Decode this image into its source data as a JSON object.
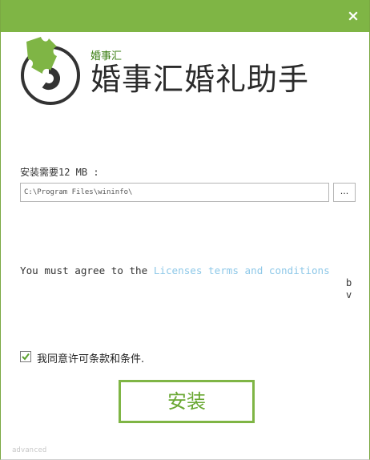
{
  "window": {
    "close_glyph": "×"
  },
  "header": {
    "logo_caption": "婚事汇",
    "title": "婚事汇婚礼助手"
  },
  "install": {
    "size_label": "安装需要12 MB :",
    "path_value": "C:\\Program Files\\wininfo\\",
    "browse_label": "..."
  },
  "license": {
    "prefix": "You must agree to the ",
    "link": "Licenses terms and conditions",
    "overflow_1": "b",
    "overflow_2": "v"
  },
  "agree": {
    "checked": true,
    "label": "我同意许可条款和条件."
  },
  "actions": {
    "install_label": "安装",
    "advanced_label": "advanced"
  },
  "colors": {
    "brand_green": "#7fb545",
    "link_blue": "#8ec8e8",
    "title_text": "#2b2b2b"
  }
}
